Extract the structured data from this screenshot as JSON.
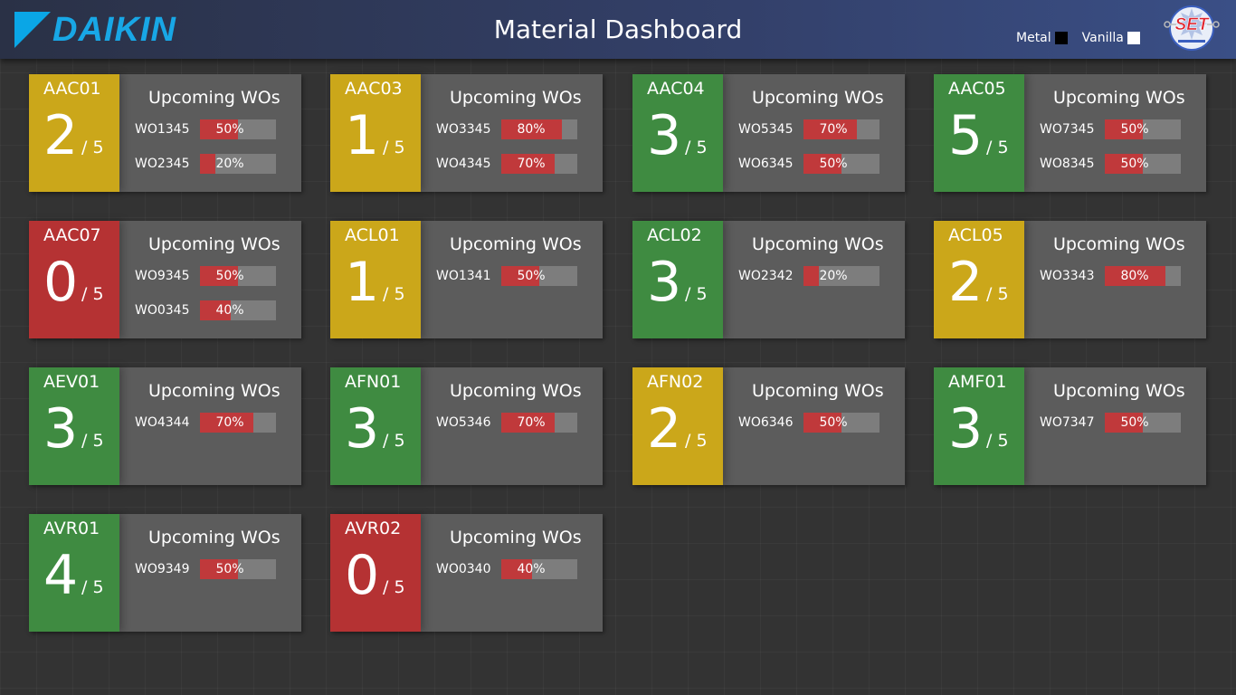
{
  "header": {
    "logo_text": "DAIKIN",
    "title": "Material Dashboard",
    "legend": [
      {
        "label": "Metal",
        "color": "#000000"
      },
      {
        "label": "Vanilla",
        "color": "#ffffff"
      }
    ],
    "set_logo_text": "SET"
  },
  "status_colors": {
    "yellow": "#cba71a",
    "green": "#3f8b41",
    "red": "#b53233"
  },
  "common": {
    "upcoming_label": "Upcoming WOs",
    "total": "/ 5"
  },
  "machines": [
    {
      "name": "AAC01",
      "count": "2",
      "status": "yellow",
      "wos": [
        {
          "id": "WO1345",
          "pct": "50%",
          "value": 50
        },
        {
          "id": "WO2345",
          "pct": "20%",
          "value": 20
        }
      ]
    },
    {
      "name": "AAC03",
      "count": "1",
      "status": "yellow",
      "wos": [
        {
          "id": "WO3345",
          "pct": "80%",
          "value": 80
        },
        {
          "id": "WO4345",
          "pct": "70%",
          "value": 70
        }
      ]
    },
    {
      "name": "AAC04",
      "count": "3",
      "status": "green",
      "wos": [
        {
          "id": "WO5345",
          "pct": "70%",
          "value": 70
        },
        {
          "id": "WO6345",
          "pct": "50%",
          "value": 50
        }
      ]
    },
    {
      "name": "AAC05",
      "count": "5",
      "status": "green",
      "wos": [
        {
          "id": "WO7345",
          "pct": "50%",
          "value": 50
        },
        {
          "id": "WO8345",
          "pct": "50%",
          "value": 50
        }
      ]
    },
    {
      "name": "AAC07",
      "count": "0",
      "status": "red",
      "wos": [
        {
          "id": "WO9345",
          "pct": "50%",
          "value": 50
        },
        {
          "id": "WO0345",
          "pct": "40%",
          "value": 40
        }
      ]
    },
    {
      "name": "ACL01",
      "count": "1",
      "status": "yellow",
      "wos": [
        {
          "id": "WO1341",
          "pct": "50%",
          "value": 50
        }
      ]
    },
    {
      "name": "ACL02",
      "count": "3",
      "status": "green",
      "wos": [
        {
          "id": "WO2342",
          "pct": "20%",
          "value": 20
        }
      ]
    },
    {
      "name": "ACL05",
      "count": "2",
      "status": "yellow",
      "wos": [
        {
          "id": "WO3343",
          "pct": "80%",
          "value": 80
        }
      ]
    },
    {
      "name": "AEV01",
      "count": "3",
      "status": "green",
      "wos": [
        {
          "id": "WO4344",
          "pct": "70%",
          "value": 70
        }
      ]
    },
    {
      "name": "AFN01",
      "count": "3",
      "status": "green",
      "wos": [
        {
          "id": "WO5346",
          "pct": "70%",
          "value": 70
        }
      ]
    },
    {
      "name": "AFN02",
      "count": "2",
      "status": "yellow",
      "wos": [
        {
          "id": "WO6346",
          "pct": "50%",
          "value": 50
        }
      ]
    },
    {
      "name": "AMF01",
      "count": "3",
      "status": "green",
      "wos": [
        {
          "id": "WO7347",
          "pct": "50%",
          "value": 50
        }
      ]
    },
    {
      "name": "AVR01",
      "count": "4",
      "status": "green",
      "wos": [
        {
          "id": "WO9349",
          "pct": "50%",
          "value": 50
        }
      ]
    },
    {
      "name": "AVR02",
      "count": "0",
      "status": "red",
      "wos": [
        {
          "id": "WO0340",
          "pct": "40%",
          "value": 40
        }
      ]
    }
  ]
}
